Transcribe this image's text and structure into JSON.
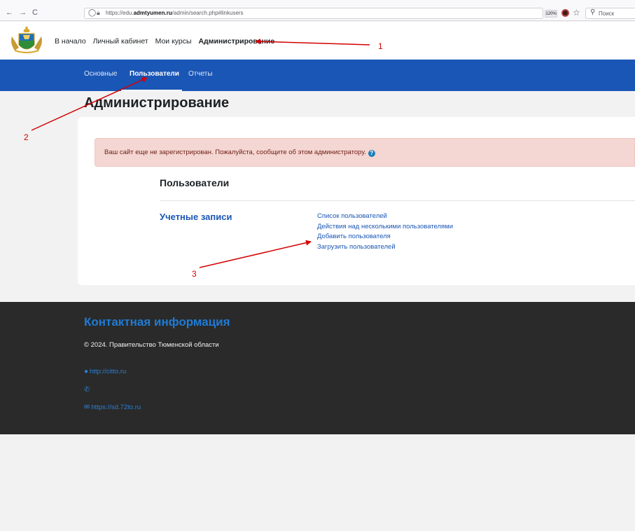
{
  "browser": {
    "back": "←",
    "forward": "→",
    "reload": "C",
    "url_prefix": "https://edu.",
    "url_domain": "admtyumen.ru",
    "url_path": "/admin/search.php#linkusers",
    "zoom": "120%",
    "search_placeholder": "Поиск"
  },
  "header": {
    "nav": [
      {
        "label": "В начало"
      },
      {
        "label": "Личный кабинет"
      },
      {
        "label": "Мои курсы"
      },
      {
        "label": "Администрирование"
      }
    ]
  },
  "subnav": {
    "items": [
      {
        "label": "Основные"
      },
      {
        "label": "Пользователи"
      },
      {
        "label": "Отчеты"
      }
    ]
  },
  "main": {
    "title": "Администрирование",
    "alert": "Ваш сайт еще не зарегистрирован. Пожалуйста, сообщите об этом администратору.",
    "help": "?",
    "section": "Пользователи",
    "category": "Учетные записи",
    "links": [
      "Список пользователей",
      "Действия над несколькими пользователями",
      "Добавить пользователя",
      "Загрузить пользователей"
    ]
  },
  "footer": {
    "title": "Контактная информация",
    "copyright": "© 2024. Правительство Тюменской области",
    "website": "http://citto.ru",
    "support": "https://sd.72to.ru"
  },
  "annotations": [
    "1",
    "2",
    "3"
  ],
  "colors": {
    "accent": "#1a56b5",
    "annotation": "#d40000",
    "footer_bg": "#2a2a2a",
    "alert_bg": "#f4d6d2"
  }
}
